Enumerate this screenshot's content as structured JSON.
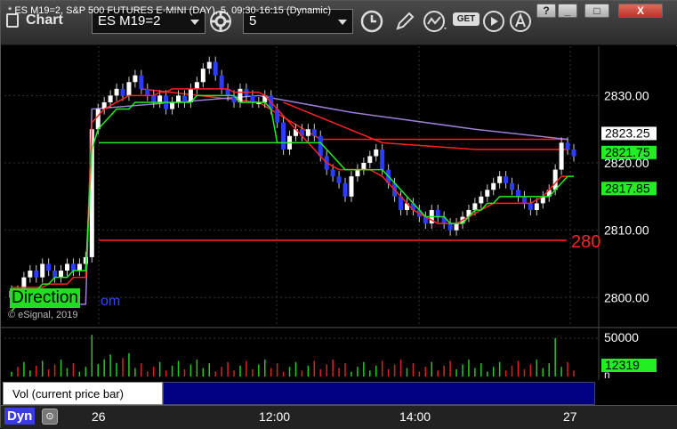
{
  "window": {
    "title": "Chart",
    "symbol_value": "ES M19=2",
    "interval_value": "5",
    "get_label": "GET",
    "buttons": {
      "help": "?",
      "minimize": "_",
      "maximize": "□",
      "close": "X"
    }
  },
  "chart": {
    "header": "* ES M19=2, S&P 500 FUTURES E-MINI (DAY), 5, 09:30-16:15 (Dynamic)",
    "direction_label": "Direction",
    "direction_link": "om",
    "copyright": "© eSignal, 2019",
    "partial_level_label": "280",
    "price_axis": {
      "ticks": [
        "2830.00",
        "2820.00",
        "2810.00",
        "2800.00"
      ],
      "tick_values": [
        2830,
        2820,
        2810,
        2800
      ],
      "labels": [
        {
          "text": "2823.25",
          "value": 2823.25,
          "bg": "#ffffff",
          "fg": "#000000"
        },
        {
          "text": "2821.75",
          "value": 2821.75,
          "bg": "#22ee22",
          "fg": "#000000"
        },
        {
          "text": "2817.85",
          "value": 2817.85,
          "bg": "#22ee22",
          "fg": "#000000"
        }
      ]
    },
    "levels": {
      "red_level": 2808.5
    }
  },
  "volume": {
    "label": "Vol (current price bar)",
    "close_glyph": "x",
    "axis_ticks": [
      "50000"
    ],
    "tick_values": [
      50000
    ],
    "current_label": "12319",
    "current_value": 12319,
    "axis_suffix": "n"
  },
  "time_axis": {
    "labels": [
      "26",
      "12:00",
      "14:00",
      "27"
    ],
    "dyn_label": "Dyn",
    "lock_icon": "🔒"
  },
  "colors": {
    "up_candle": "#ffffff",
    "down_candle": "#2a3cff",
    "green_line": "#22ee22",
    "red_line": "#ff2222",
    "purple_line": "#9a7fd6",
    "volume_up": "#22cc22",
    "volume_down": "#dd2222"
  },
  "chart_data": {
    "type": "candlestick",
    "title": "* ES M19=2, S&P 500 FUTURES E-MINI (DAY), 5, 09:30-16:15 (Dynamic)",
    "ylim": [
      2797,
      2836
    ],
    "closes": [
      2801,
      2800,
      2803,
      2804,
      2803,
      2805,
      2804,
      2803,
      2804,
      2805,
      2804,
      2805,
      2806,
      2825,
      2828,
      2829,
      2830,
      2831,
      2830,
      2832,
      2833,
      2831,
      2830,
      2829,
      2830,
      2828,
      2829,
      2830,
      2829,
      2831,
      2832,
      2834,
      2835,
      2833,
      2831,
      2830,
      2829,
      2831,
      2830,
      2829,
      2829,
      2830,
      2828,
      2826,
      2822,
      2824,
      2825,
      2824,
      2825,
      2824,
      2821,
      2819,
      2818,
      2817,
      2815,
      2818,
      2819,
      2820,
      2821,
      2822,
      2819,
      2817,
      2815,
      2813,
      2814,
      2813,
      2812,
      2811,
      2813,
      2812,
      2811,
      2810,
      2811,
      2812,
      2813,
      2814,
      2815,
      2816,
      2817,
      2818,
      2817,
      2816,
      2815,
      2814,
      2813,
      2814,
      2815,
      2816,
      2819,
      2823,
      2822,
      2821
    ],
    "green_ma": [
      2798,
      2799,
      2800,
      2801,
      2801,
      2802,
      2802,
      2803,
      2803,
      2803,
      2804,
      2804,
      2804,
      2822,
      2825,
      2826,
      2827,
      2828,
      2828,
      2828,
      2829,
      2829,
      2829,
      2829,
      2829,
      2829,
      2829,
      2829,
      2829,
      2829,
      2830,
      2830,
      2830,
      2830,
      2830,
      2830,
      2830,
      2829,
      2829,
      2829,
      2829,
      2829,
      2828,
      2823,
      2823,
      2823,
      2823,
      2823,
      2823,
      2823,
      2823,
      2822,
      2821,
      2820,
      2819,
      2819,
      2819,
      2819,
      2819,
      2819,
      2819,
      2818,
      2817,
      2816,
      2815,
      2814,
      2813,
      2812,
      2812,
      2812,
      2812,
      2811,
      2811,
      2811,
      2812,
      2813,
      2813,
      2814,
      2814,
      2815,
      2815,
      2815,
      2815,
      2815,
      2815,
      2815,
      2815,
      2815,
      2816,
      2817,
      2818,
      2818
    ],
    "red_ma": [
      2801.5,
      2801.5,
      2801.5,
      2801.5,
      2801.5,
      2801.5,
      2802,
      2802,
      2802,
      2802,
      2803,
      2803,
      2803,
      2826,
      2827,
      2828,
      2828.5,
      2829,
      2829.5,
      2830,
      2830,
      2830,
      2830,
      2830,
      2830.5,
      2830.5,
      2831,
      2831,
      2831,
      2831,
      2831,
      2831,
      2831,
      2831,
      2831,
      2831,
      2830.5,
      2830.5,
      2830.5,
      2830.5,
      2830.5,
      2830,
      2829,
      2828,
      2827,
      2826,
      2825,
      2824,
      2823,
      2822,
      2821,
      2820,
      2819.5,
      2819,
      2819,
      2819,
      2819,
      2819,
      2819,
      2818.5,
      2818,
      2817,
      2816,
      2815,
      2814,
      2813,
      2812.5,
      2812,
      2811.5,
      2811,
      2811,
      2811,
      2811,
      2811.5,
      2812,
      2812.5,
      2813,
      2813.5,
      2814,
      2814,
      2814,
      2814,
      2814,
      2814,
      2814,
      2814.5,
      2815,
      2816,
      2817,
      2818,
      2818
    ]
  }
}
